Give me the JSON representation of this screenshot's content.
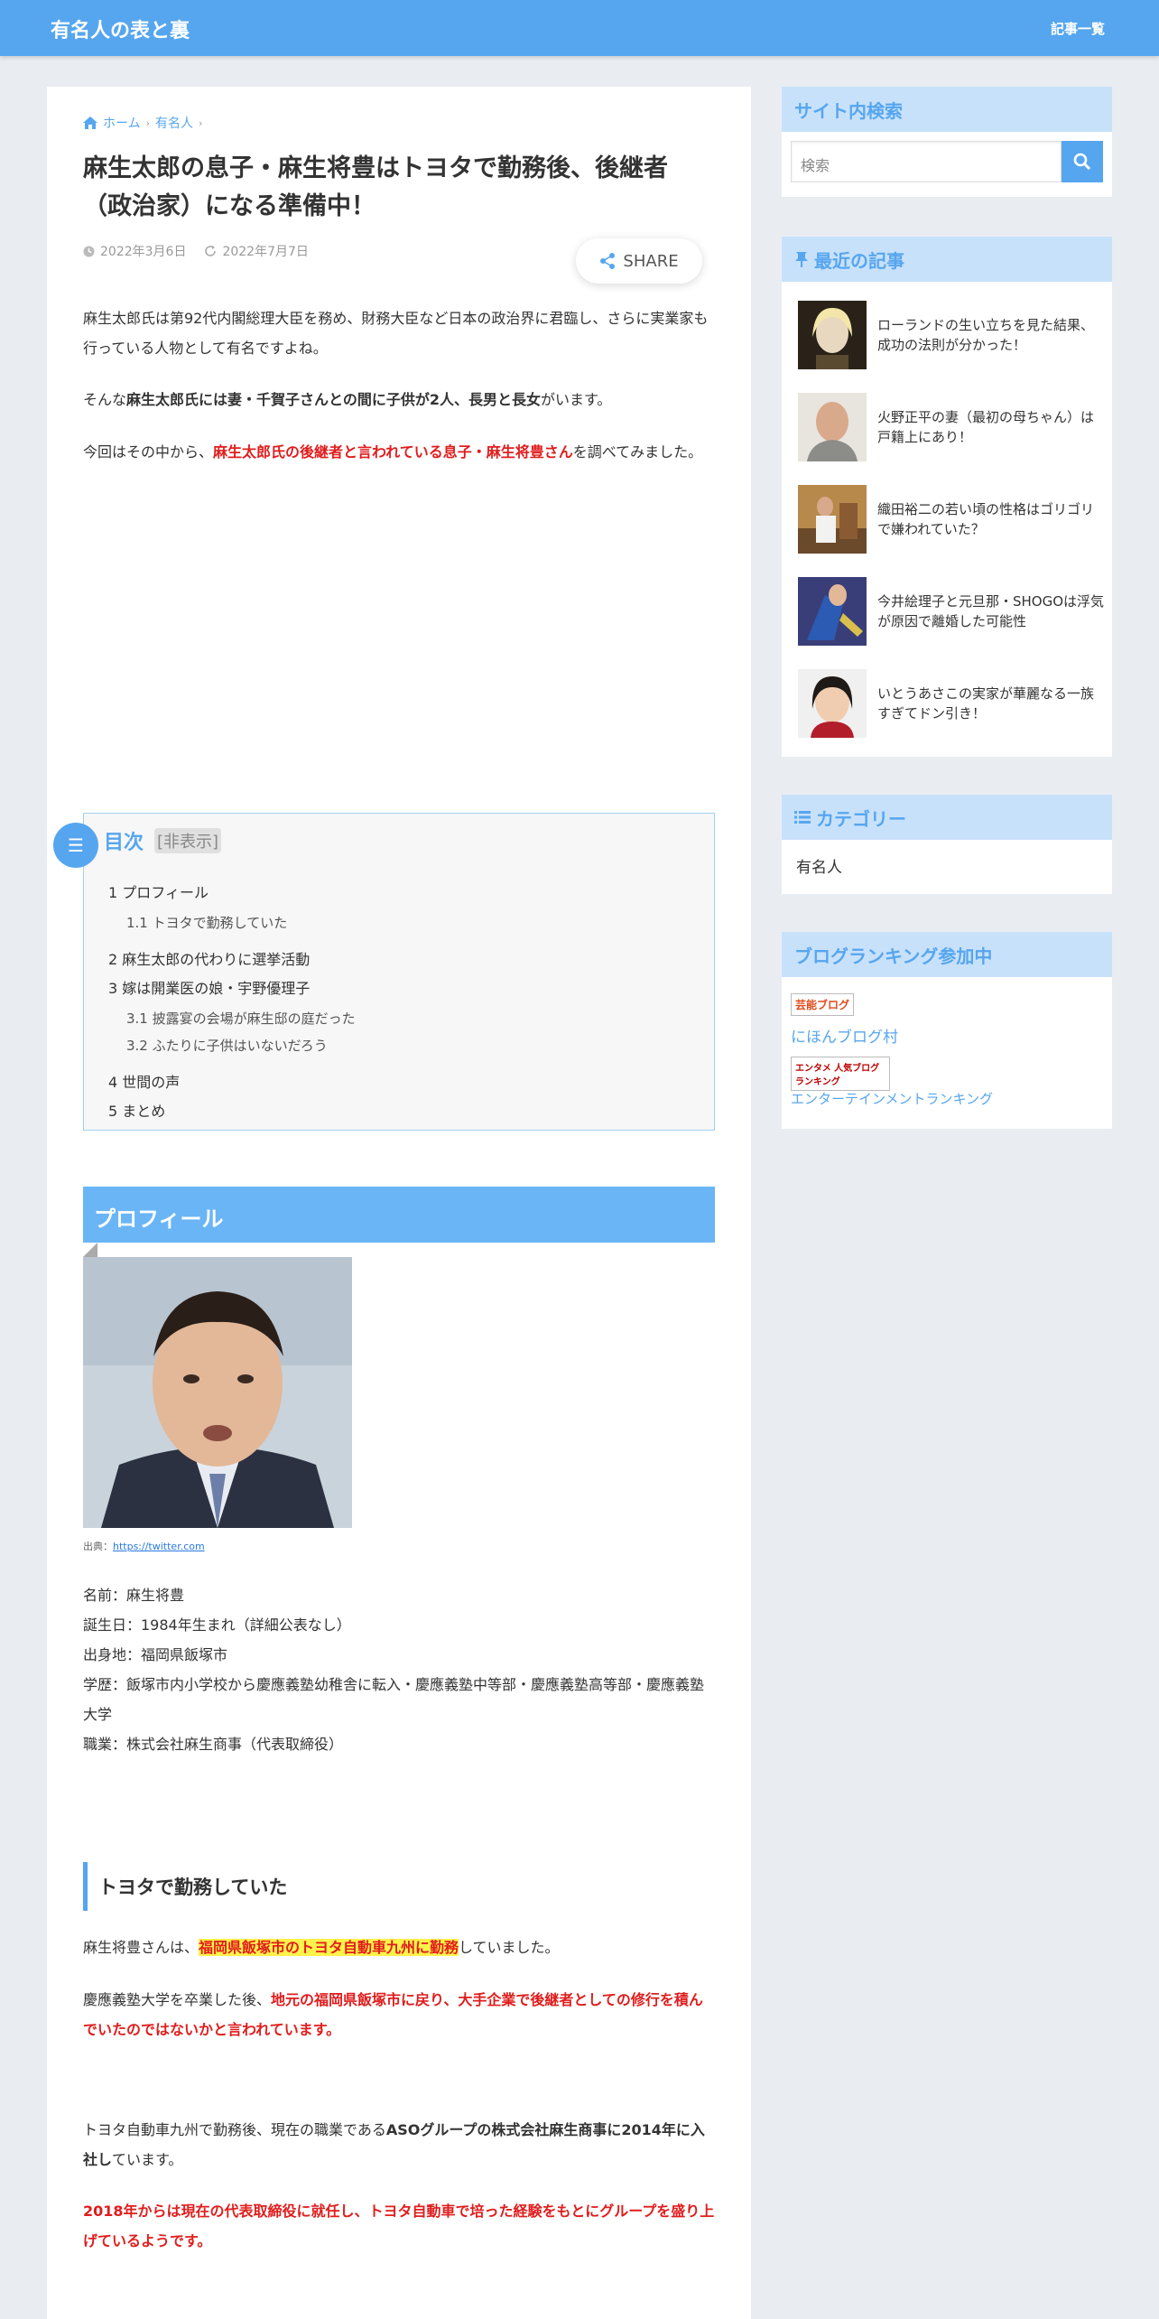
{
  "header": {
    "site_title": "有名人の表と裏",
    "nav_link": "記事一覧"
  },
  "breadcrumb": {
    "home": "ホーム",
    "category": "有名人"
  },
  "article": {
    "title": "麻生太郎の息子・麻生将豊はトヨタで勤務後、後継者（政治家）になる準備中！",
    "published": "2022年3月6日",
    "updated": "2022年7月7日",
    "share_label": "SHARE",
    "intro1": "麻生太郎氏は第92代内閣総理大臣を務め、財務大臣など日本の政治界に君臨し、さらに実業家も行っている人物として有名ですよね。",
    "intro2_pre": "そんな",
    "intro2_bold": "麻生太郎氏には妻・千賀子さんとの間に子供が2人、長男と長女",
    "intro2_post": "がいます。",
    "intro3_pre": "今回はその中から、",
    "intro3_red": "麻生太郎氏の後継者と言われている息子・麻生将豊さん",
    "intro3_post": "を調べてみました。"
  },
  "toc": {
    "title": "目次",
    "toggle": "[非表示]",
    "items": [
      {
        "num": "1",
        "label": "プロフィール"
      },
      {
        "num": "1.1",
        "label": "トヨタで勤務していた"
      },
      {
        "num": "2",
        "label": "麻生太郎の代わりに選挙活動"
      },
      {
        "num": "3",
        "label": "嫁は開業医の娘・宇野優理子"
      },
      {
        "num": "3.1",
        "label": "披露宴の会場が麻生邸の庭だった"
      },
      {
        "num": "3.2",
        "label": "ふたりに子供はいないだろう"
      },
      {
        "num": "4",
        "label": "世間の声"
      },
      {
        "num": "5",
        "label": "まとめ"
      }
    ]
  },
  "profile": {
    "heading": "プロフィール",
    "caption_label": "出典：",
    "caption_link": "https://twitter.com",
    "name": "名前：麻生将豊",
    "birth": "誕生日：1984年生まれ（詳細公表なし）",
    "hometown": "出身地：福岡県飯塚市",
    "education": "学歴：飯塚市内小学校から慶應義塾幼稚舎に転入・慶應義塾中等部・慶應義塾高等部・慶應義塾大学",
    "job": "職業：株式会社麻生商事（代表取締役）"
  },
  "toyota": {
    "heading": "トヨタで勤務していた",
    "p1_pre": "麻生将豊さんは、",
    "p1_hl": "福岡県飯塚市のトヨタ自動車九州に勤務",
    "p1_post": "していました。",
    "p2_pre": "慶應義塾大学を卒業した後、",
    "p2_red": "地元の福岡県飯塚市に戻り、大手企業で後継者としての修行を積んでいたのではないかと言われています。",
    "p3_pre": "トヨタ自動車九州で勤務後、現在の職業である",
    "p3_bold": "ASOグループの株式会社麻生商事に2014年に入社し",
    "p3_post": "ています。",
    "p4_red": "2018年からは現在の代表取締役に就任し、トヨタ自動車で培った経験をもとにグループを盛り上げているようです。"
  },
  "sidebar": {
    "search_title": "サイト内検索",
    "search_placeholder": "検索",
    "recent_title": "最近の記事",
    "recent": [
      {
        "title": "ローランドの生い立ちを見た結果、成功の法則が分かった！"
      },
      {
        "title": "火野正平の妻（最初の母ちゃん）は戸籍上にあり！"
      },
      {
        "title": "織田裕二の若い頃の性格はゴリゴリで嫌われていた？"
      },
      {
        "title": "今井絵理子と元旦那・SHOGOは浮気が原因で離婚した可能性"
      },
      {
        "title": "いとうあさこの実家が華麗なる一族すぎてドン引き！"
      }
    ],
    "category_title": "カテゴリー",
    "category_item": "有名人",
    "ranking_title": "ブログランキング参加中",
    "rank1_badge": "芸能ブログ",
    "rank1_link": "にほんブログ村",
    "rank2_badge": "エンタメ 人気ブログランキング",
    "rank2_link": "エンターテインメントランキング"
  },
  "colors": {
    "accent": "#56a6ef",
    "red": "#e01d1d",
    "highlight": "#fff24a"
  }
}
